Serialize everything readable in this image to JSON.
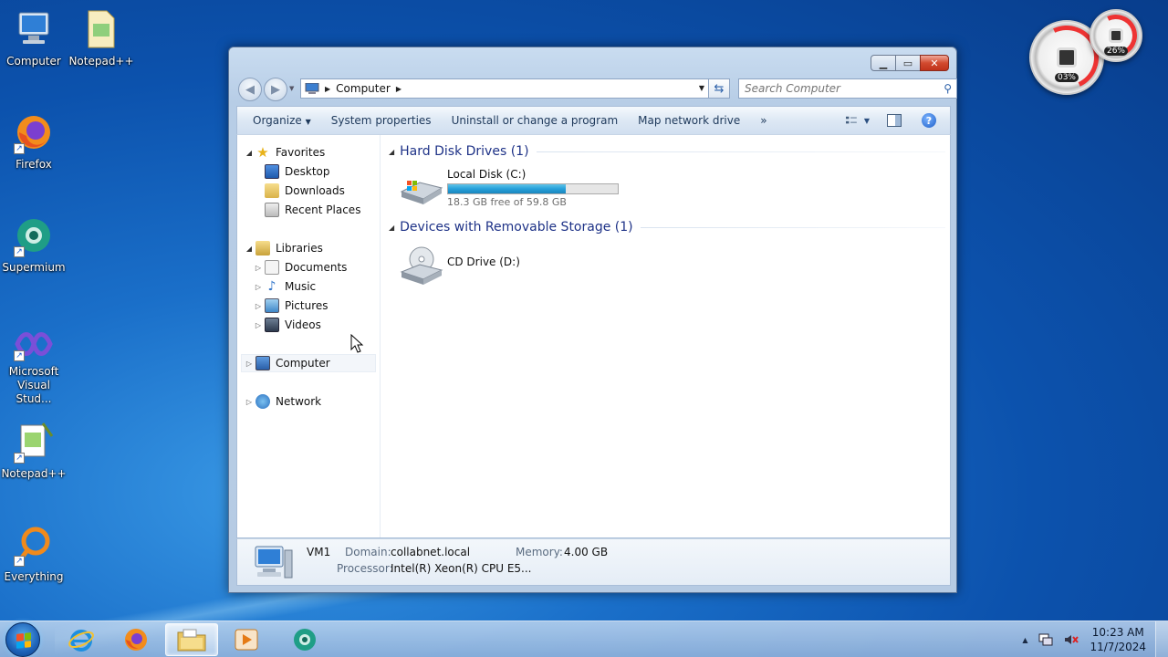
{
  "desktop": {
    "icons": [
      {
        "label": "Computer"
      },
      {
        "label": "Notepad++"
      },
      {
        "label": "Firefox"
      },
      {
        "label": "Supermium"
      },
      {
        "label": "Microsoft Visual Stud..."
      },
      {
        "label": "Notepad++"
      },
      {
        "label": "Everything"
      }
    ]
  },
  "gadget": {
    "cpu_percent": "03%",
    "memory_percent": "26%"
  },
  "window": {
    "address": {
      "crumb": "Computer"
    },
    "search": {
      "placeholder": "Search Computer"
    },
    "toolbar": {
      "organize": "Organize",
      "system_properties": "System properties",
      "uninstall": "Uninstall or change a program",
      "map_drive": "Map network drive",
      "more": "»"
    },
    "nav": {
      "favorites": "Favorites",
      "desktop": "Desktop",
      "downloads": "Downloads",
      "recent": "Recent Places",
      "libraries": "Libraries",
      "documents": "Documents",
      "music": "Music",
      "pictures": "Pictures",
      "videos": "Videos",
      "computer": "Computer",
      "network": "Network"
    },
    "groups": {
      "hdd_title": "Hard Disk Drives (1)",
      "removable_title": "Devices with Removable Storage (1)"
    },
    "drives": {
      "c_name": "Local Disk (C:)",
      "c_free": "18.3 GB free of 59.8 GB",
      "c_used_fraction": 0.694,
      "d_name": "CD Drive (D:)"
    },
    "details": {
      "name": "VM1",
      "domain_label": "Domain:",
      "domain": "collabnet.local",
      "memory_label": "Memory:",
      "memory": "4.00 GB",
      "processor_label": "Processor:",
      "processor": "Intel(R) Xeon(R) CPU E5..."
    }
  },
  "taskbar": {
    "time": "10:23 AM",
    "date": "11/7/2024",
    "tray_up": "▲"
  },
  "colors": {
    "accent_blue": "#1e3287",
    "progress": "#26a0da"
  }
}
